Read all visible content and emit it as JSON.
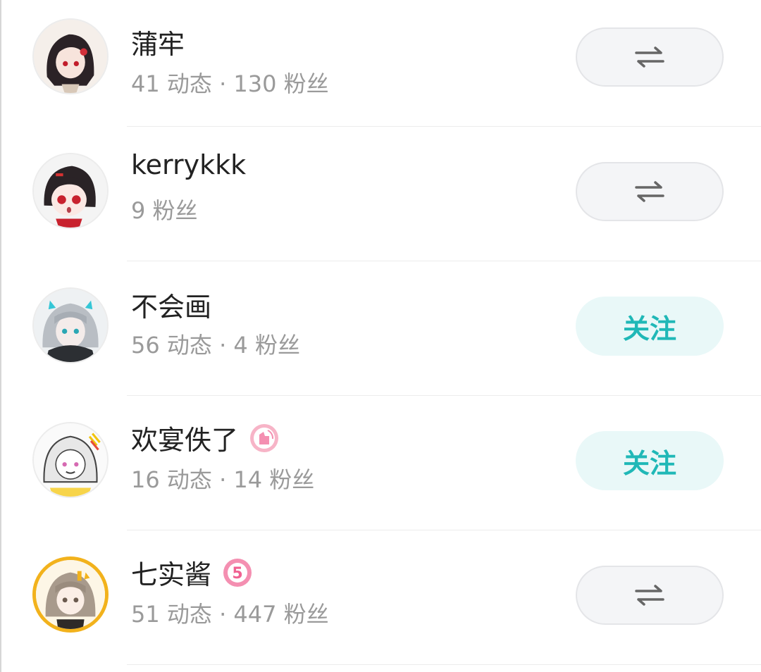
{
  "users": [
    {
      "name": "蒲牢",
      "stats": "41 动态 · 130 粉丝",
      "button": "mutual",
      "badge": null
    },
    {
      "name": "kerrykkk",
      "stats": "9 粉丝",
      "button": "mutual",
      "badge": null
    },
    {
      "name": "不会画",
      "stats": "56 动态 · 4 粉丝",
      "button": "follow",
      "button_label": "关注",
      "badge": null
    },
    {
      "name": "欢宴佚了",
      "stats": "16 动态 · 14 粉丝",
      "button": "follow",
      "button_label": "关注",
      "badge": "anniversary-badge-icon"
    },
    {
      "name": "七实酱",
      "stats": "51 动态 · 447 粉丝",
      "button": "mutual",
      "badge": "level-5-badge-icon",
      "badge_text": "5"
    }
  ],
  "colors": {
    "accent": "#20b8b7",
    "follow_bg": "#e9f8f8",
    "mutual_bg": "#f4f5f7",
    "badge_pink": "#f48fb1"
  }
}
